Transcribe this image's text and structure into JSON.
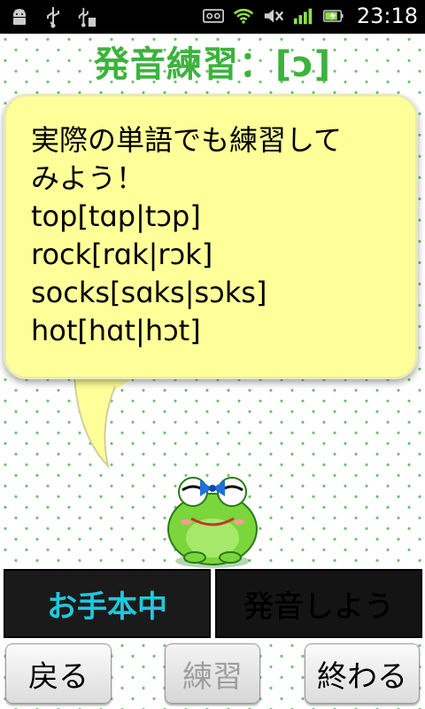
{
  "status_bar": {
    "time": "23:18",
    "left_icons": [
      "android-debug-icon",
      "usb-icon",
      "usb-storage-icon"
    ],
    "right_icons": [
      "voicemail-icon",
      "wifi-icon",
      "mute-icon",
      "signal-icon",
      "battery-charging-icon"
    ]
  },
  "title": "発音練習：[ɔ]",
  "bubble": {
    "text": "実際の単語でも練習して\nみよう！\ntop[tɑp|tɔp]\nrock[rɑk|rɔk]\nsocks[sɑks|sɔks]\nhot[hɑt|hɔt]"
  },
  "mode_buttons": {
    "model_label": "お手本中",
    "pronounce_label": "発音しよう"
  },
  "nav_buttons": {
    "back_label": "戻る",
    "practice_label": "練習",
    "end_label": "終わる"
  },
  "colors": {
    "title": "#3cb33c",
    "bubble": "#ffff99",
    "active_mode_text": "#22c8dc",
    "dot": "#6cc36c"
  }
}
